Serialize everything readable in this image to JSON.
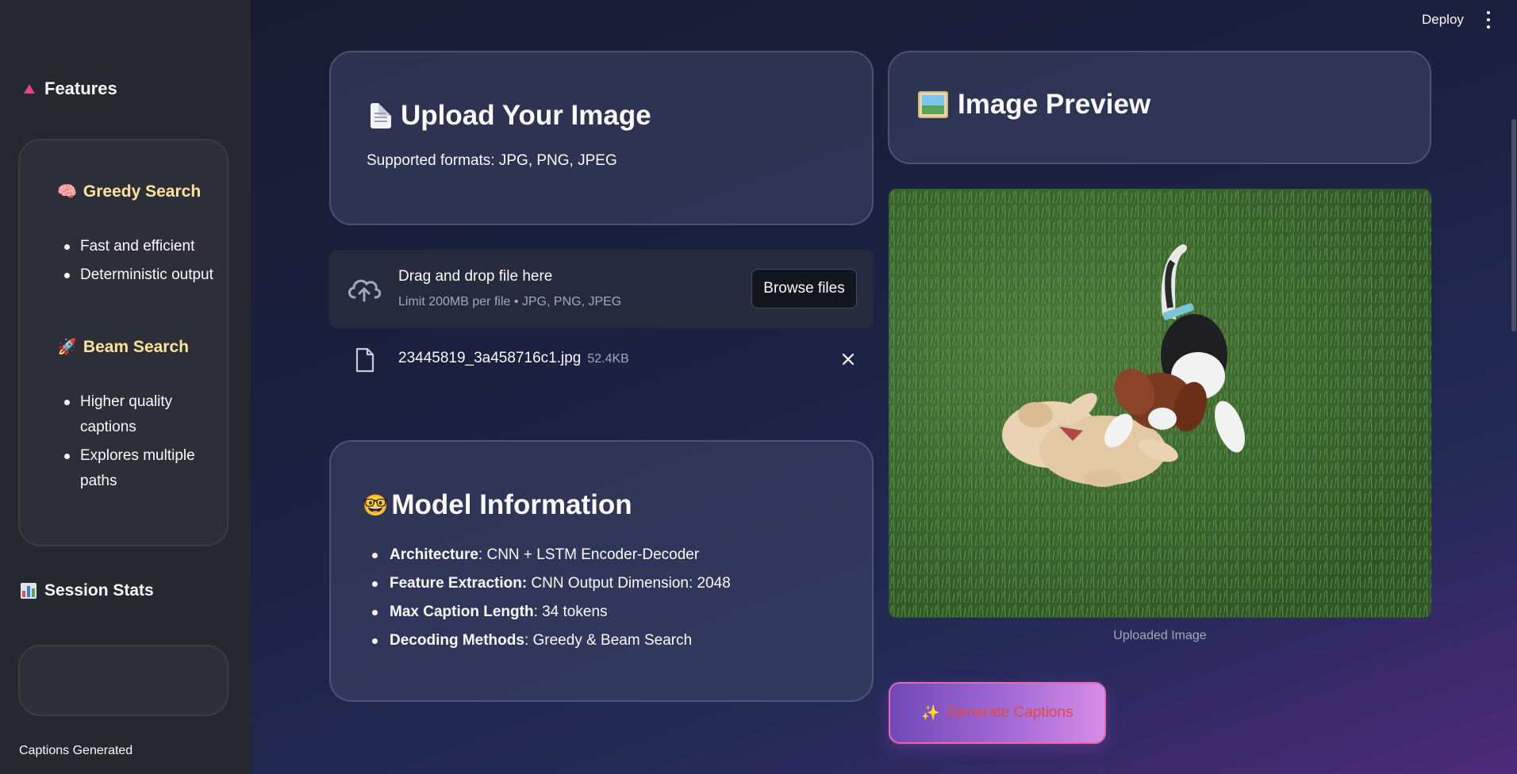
{
  "header": {
    "deploy_label": "Deploy"
  },
  "sidebar": {
    "features_heading": "Features",
    "greedy": {
      "title": "Greedy Search",
      "items": [
        "Fast and efficient",
        "Deterministic output"
      ]
    },
    "beam": {
      "title": "Beam Search",
      "items": [
        "Higher quality captions",
        "Explores multiple paths"
      ]
    },
    "stats_heading": "Session Stats",
    "captions_label": "Captions Generated"
  },
  "upload": {
    "title": "Upload Your Image",
    "subtitle": "Supported formats: JPG, PNG, JPEG",
    "drop_main": "Drag and drop file here",
    "drop_sub": "Limit 200MB per file • JPG, PNG, JPEG",
    "browse_label": "Browse files",
    "file_name": "23445819_3a458716c1.jpg",
    "file_size": "52.4KB"
  },
  "model": {
    "title": "Model Information",
    "items": [
      {
        "key": "Architecture",
        "value": ": CNN + LSTM Encoder-Decoder"
      },
      {
        "key": "Feature Extraction:",
        "value": " CNN Output Dimension: 2048"
      },
      {
        "key": "Max Caption Length",
        "value": ": 34 tokens"
      },
      {
        "key": "Decoding Methods",
        "value": ": Greedy & Beam Search"
      }
    ]
  },
  "preview": {
    "title": "Image Preview",
    "image_caption": "Uploaded Image"
  },
  "actions": {
    "generate_label": "Generate Captions"
  },
  "colors": {
    "accent_pink": "#e26ab4",
    "feature_title": "#fde49a",
    "button_text": "#e8473d"
  },
  "icons": [
    "triangle-icon",
    "brain-icon",
    "rocket-icon",
    "bar-chart-icon",
    "document-icon",
    "cloud-upload-icon",
    "file-icon",
    "close-icon",
    "nerd-face-icon",
    "framed-picture-icon",
    "sparkles-icon",
    "kebab-menu-icon"
  ]
}
